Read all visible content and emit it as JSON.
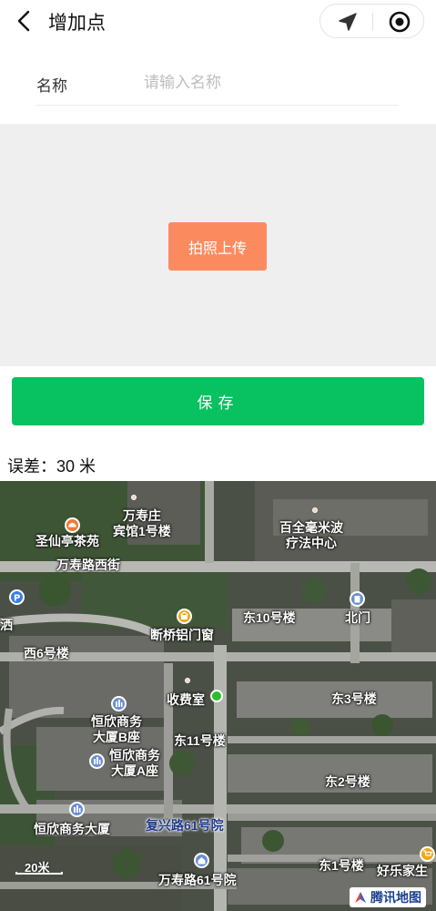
{
  "header": {
    "title": "增加点",
    "back_icon": "chevron-left-icon",
    "location_icon": "navigation-arrow-icon",
    "target_icon": "target-icon"
  },
  "form": {
    "name_label": "名称",
    "name_value": "",
    "name_placeholder": "请输入名称",
    "upload_label": "拍照上传",
    "save_label": "保存"
  },
  "error_text": "误差：30 米",
  "map": {
    "labels": [
      "万寿庄\n宾馆1号楼",
      "百全毫米波\n疗法中心",
      "圣仙亭茶苑",
      "万寿路西街",
      "断桥铝门窗",
      "东10号楼",
      "北门",
      "西6号楼",
      "收费室",
      "东3号楼",
      "恒欣商务\n大厦B座",
      "东11号楼",
      "恒欣商务\n大厦A座",
      "东2号楼",
      "恒欣商务大厦",
      "东1号楼",
      "万寿路61号院",
      "好乐家生",
      "洒"
    ],
    "road_label": "复兴路61号院",
    "scale_label": "20米",
    "logo_label": "腾讯地图",
    "colors": {
      "accent_green": "#08c160",
      "upload_orange": "#fb8b5f",
      "gps_green": "#27c02a"
    }
  }
}
